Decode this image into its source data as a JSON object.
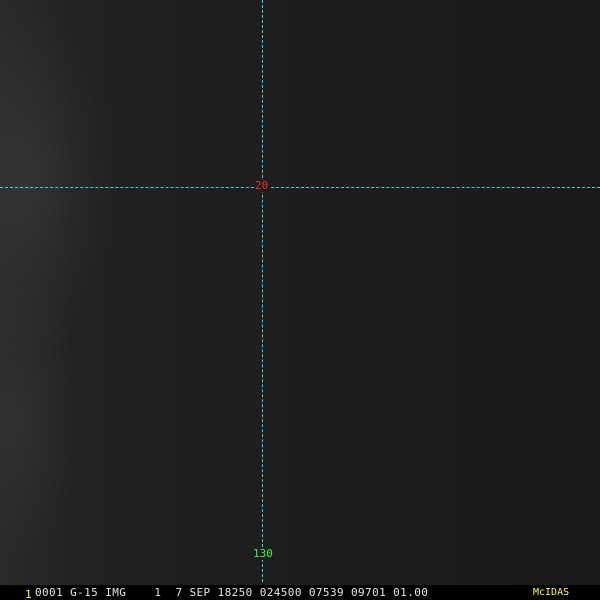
{
  "overlay": {
    "latitude_label": "20",
    "longitude_label": "130"
  },
  "status_bar": {
    "frame_number": "1",
    "info": "0001 G-15 IMG    1  7 SEP 18250 024500 07539 09701 01.00",
    "brand": "McIDAS"
  },
  "colors": {
    "gridline": "#33d6d6",
    "latitude_label": "#ff2a2a",
    "longitude_label": "#33ff33",
    "frame_number": "#ffff33",
    "brand": "#ffff33",
    "status_text": "#e6e6e6"
  }
}
